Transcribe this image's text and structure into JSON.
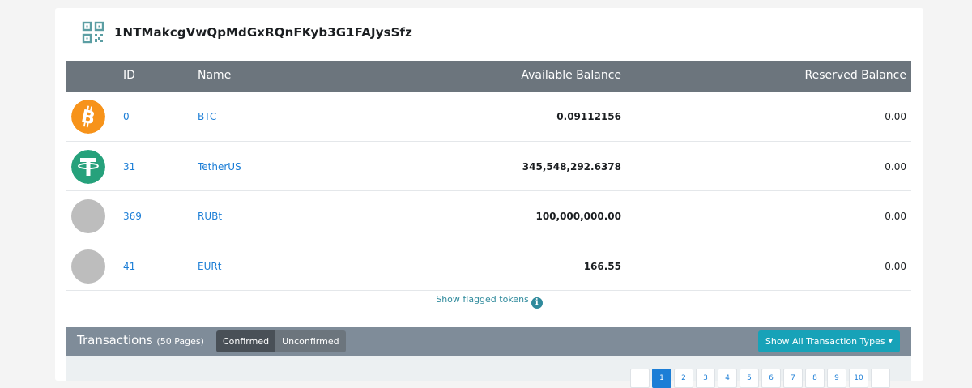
{
  "address": "1NTMakcgVwQpMdGxRQnFKyb3G1FAJysSfz",
  "table": {
    "headers": {
      "id": "ID",
      "name": "Name",
      "available": "Available Balance",
      "reserved": "Reserved Balance"
    },
    "rows": [
      {
        "icon": "bitcoin-icon",
        "id": "0",
        "name": "BTC",
        "available": "0.09112156",
        "reserved": "0.00"
      },
      {
        "icon": "tether-icon",
        "id": "31",
        "name": "TetherUS",
        "available": "345,548,292.6378",
        "reserved": "0.00"
      },
      {
        "icon": "placeholder-coin-icon",
        "id": "369",
        "name": "RUBt",
        "available": "100,000,000.00",
        "reserved": "0.00"
      },
      {
        "icon": "placeholder-coin-icon",
        "id": "41",
        "name": "EURt",
        "available": "166.55",
        "reserved": "0.00"
      }
    ]
  },
  "flagged_link": "Show flagged tokens",
  "transactions": {
    "title": "Transactions",
    "pages": "(50 Pages)",
    "confirmed": "Confirmed",
    "unconfirmed": "Unconfirmed",
    "types_button": "Show All Transaction Types"
  },
  "pagination": [
    "",
    "1",
    "2",
    "3",
    "4",
    "5",
    "6",
    "7",
    "8",
    "9",
    "10",
    ""
  ],
  "colors": {
    "bitcoin": "#f7931a",
    "tether": "#26a17b",
    "header_bg": "#6c757d",
    "link": "#1c7ed6",
    "accent": "#17a2b8"
  }
}
